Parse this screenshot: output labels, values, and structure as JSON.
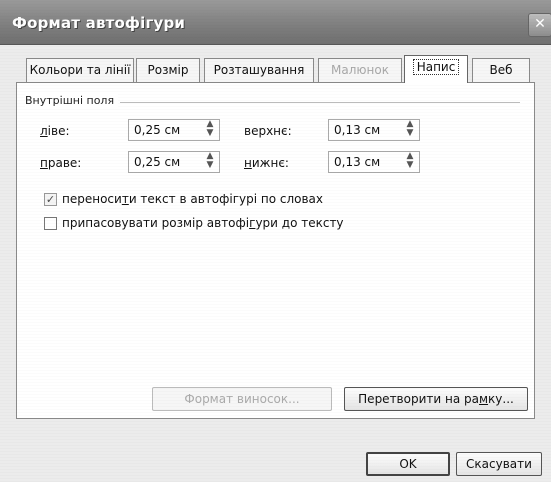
{
  "window": {
    "title": "Формат автофігури",
    "close_glyph": "✕"
  },
  "tabs": [
    {
      "label": "Кольори та лінії",
      "state": "normal"
    },
    {
      "label": "Розмір",
      "state": "normal"
    },
    {
      "label": "Розташування",
      "state": "normal"
    },
    {
      "label": "Малюнок",
      "state": "disabled"
    },
    {
      "label": "Напис",
      "state": "active"
    },
    {
      "label": "Веб",
      "state": "normal"
    }
  ],
  "internal_margins": {
    "group_title": "Внутрішні поля",
    "left": {
      "label_underlined": "л",
      "label_rest": "іве:",
      "value": "0,25 см"
    },
    "right": {
      "label_underlined": "п",
      "label_rest": "раве:",
      "value": "0,25 см"
    },
    "top": {
      "label_underlined": "",
      "label_rest": "верхнє:",
      "value": "0,13 см"
    },
    "bottom": {
      "label_underlined": "н",
      "label_rest": "ижнє:",
      "value": "0,13 см"
    }
  },
  "options": {
    "wrap_text": {
      "label_pre": "переноси",
      "label_underlined": "т",
      "label_post": "и текст в автофігурі по словах",
      "checked": true,
      "check_glyph": "✓"
    },
    "resize_shape": {
      "label_pre": "припасовувати розмір автофі",
      "label_underlined": "г",
      "label_post": "ури до тексту",
      "checked": false
    }
  },
  "buttons": {
    "format_callout": "Формат виносок...",
    "convert_frame_pre": "Перетворити на ра",
    "convert_frame_underlined": "м",
    "convert_frame_post": "ку...",
    "ok": "OK",
    "cancel": "Скасувати"
  },
  "icons": {
    "spin_up": "▲",
    "spin_down": "▼"
  }
}
